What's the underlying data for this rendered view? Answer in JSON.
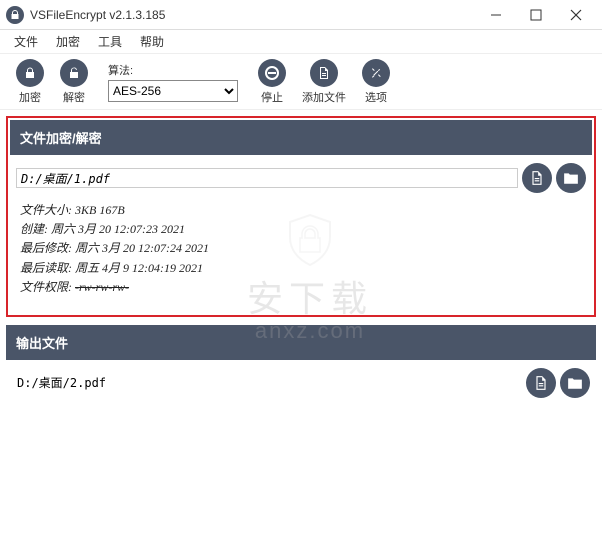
{
  "window": {
    "title": "VSFileEncrypt v2.1.3.185"
  },
  "menu": {
    "file": "文件",
    "encrypt": "加密",
    "tools": "工具",
    "help": "帮助"
  },
  "toolbar": {
    "encrypt": "加密",
    "decrypt": "解密",
    "algo_label": "算法:",
    "algo_selected": "AES-256",
    "stop": "停止",
    "add_file": "添加文件",
    "options": "选项"
  },
  "sections": {
    "input_title": "文件加密/解密",
    "output_title": "输出文件"
  },
  "input": {
    "path": "D:/桌面/1.pdf"
  },
  "file_info": {
    "size_label": "文件大小:",
    "size_value": "3KB 167B",
    "created_label": "创建:",
    "created_value": "周六 3月 20 12:07:23 2021",
    "modified_label": "最后修改:",
    "modified_value": "周六 3月 20 12:07:24 2021",
    "read_label": "最后读取:",
    "read_value": "周五 4月 9 12:04:19 2021",
    "perm_label": "文件权限:",
    "perm_value": "-rw-rw-rw-"
  },
  "output": {
    "path": "D:/桌面/2.pdf"
  },
  "watermark": {
    "brand": "安下载",
    "domain": "anxz.com"
  },
  "colors": {
    "panel": "#4a5568",
    "highlight_border": "#d8242a"
  }
}
